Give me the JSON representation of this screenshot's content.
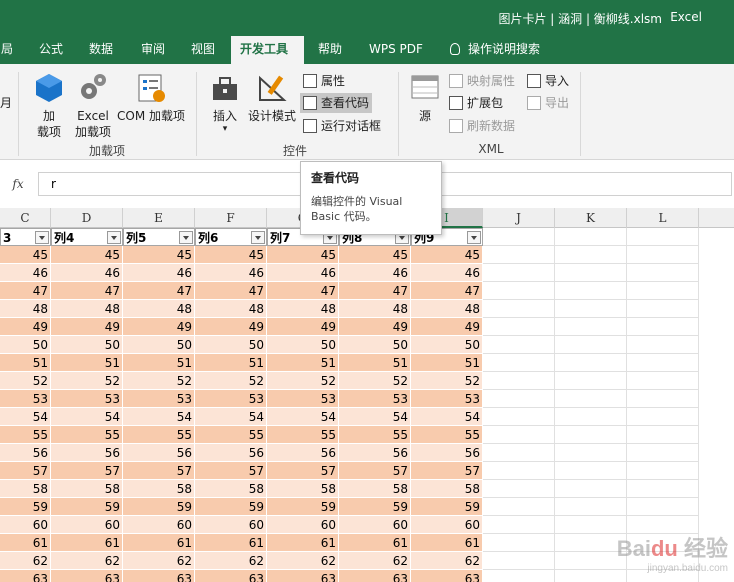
{
  "window": {
    "title": "图片卡片 | 涵洞 | 衡柳线.xlsm",
    "separator": "-",
    "app": "Excel"
  },
  "tabs": [
    {
      "label": "局",
      "active": false
    },
    {
      "label": "公式",
      "active": false
    },
    {
      "label": "数据",
      "active": false
    },
    {
      "label": "审阅",
      "active": false
    },
    {
      "label": "视图",
      "active": false
    },
    {
      "label": "开发工具",
      "active": true
    },
    {
      "label": "帮助",
      "active": false
    },
    {
      "label": "WPS PDF",
      "active": false
    },
    {
      "label": "操作说明搜索",
      "active": false
    }
  ],
  "ribbon": {
    "left_cut": "月",
    "addins": {
      "group_label": "加载项",
      "addin_btn": "加\n载项",
      "excel_addin_btn": "Excel\n加载项",
      "com_addin_btn": "COM 加载项"
    },
    "controls": {
      "group_label": "控件",
      "insert_btn": "插入",
      "design_mode_btn": "设计模式",
      "properties": "属性",
      "view_code": "查看代码",
      "run_dialog": "运行对话框"
    },
    "xml": {
      "group_label": "XML",
      "source_btn": "源",
      "map_properties": "映射属性",
      "expansion_packs": "扩展包",
      "refresh_data": "刷新数据",
      "import": "导入",
      "export": "导出"
    }
  },
  "formula_bar": {
    "fx": "fx",
    "value": "r"
  },
  "tooltip": {
    "title": "查看代码",
    "desc": "编辑控件的 Visual Basic 代码。"
  },
  "columns": [
    "C",
    "D",
    "E",
    "F",
    "G",
    "H",
    "I",
    "J",
    "K",
    "L"
  ],
  "table_headers": [
    "3",
    "列4",
    "列5",
    "列6",
    "列7",
    "列8",
    "列9"
  ],
  "rows": [
    "45",
    "46",
    "47",
    "48",
    "49",
    "50",
    "51",
    "52",
    "53",
    "54",
    "55",
    "56",
    "57",
    "58",
    "59",
    "60",
    "61",
    "62",
    "63"
  ],
  "colors": {
    "excel_green": "#217346",
    "band_dark": "#F8CBAD",
    "band_light": "#FCE4D6"
  },
  "watermark": {
    "main": "Bai 经验",
    "sub": "jingyan.baidu.com"
  }
}
